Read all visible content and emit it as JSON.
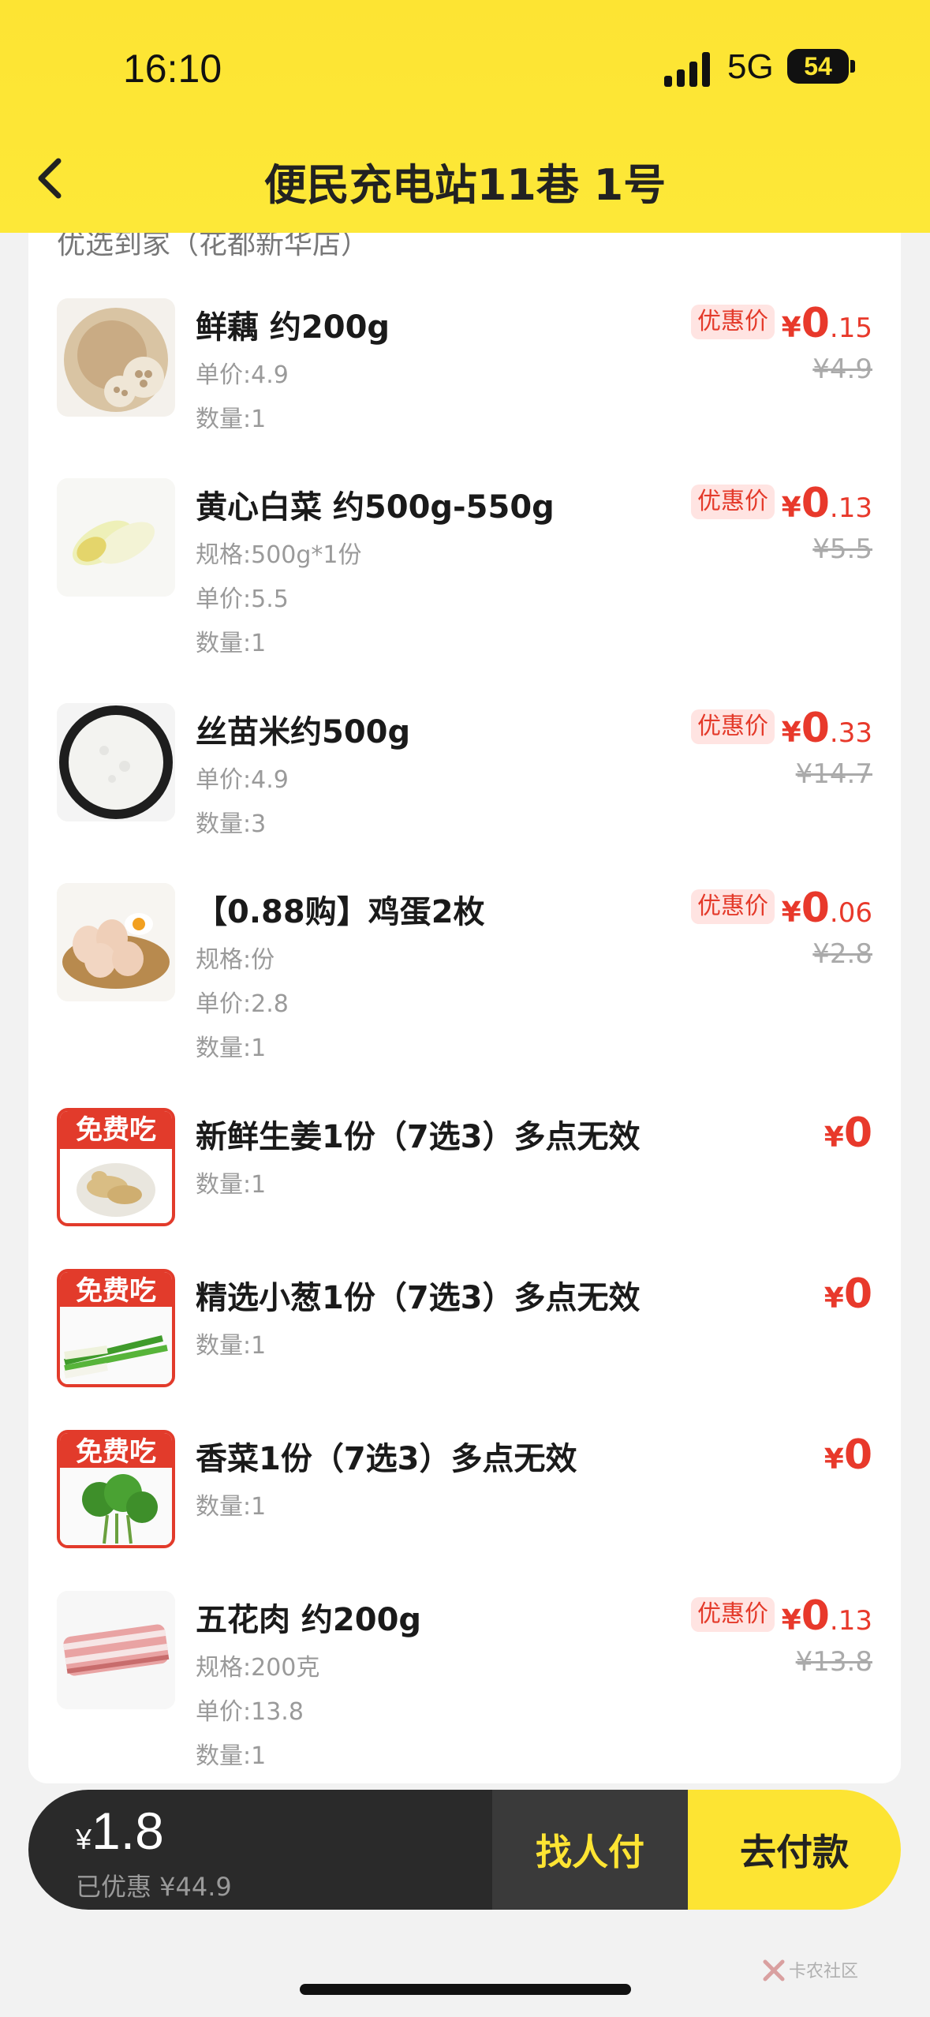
{
  "status_bar": {
    "time": "16:10",
    "network": "5G",
    "battery": "54"
  },
  "header": {
    "title": "便民充电站11巷 1号"
  },
  "store": {
    "name": "优选到家（花都新华店）"
  },
  "items": [
    {
      "name": "鲜藕 约200g",
      "spec": "",
      "unit_price": "单价:4.9",
      "quantity": "数量:1",
      "promo": "优惠价",
      "price_yen": "¥",
      "price_int": "0",
      "price_dec": ".15",
      "original": "¥4.9",
      "free": false,
      "free_label": ""
    },
    {
      "name": "黄心白菜 约500g-550g",
      "spec": "规格:500g*1份",
      "unit_price": "单价:5.5",
      "quantity": "数量:1",
      "promo": "优惠价",
      "price_yen": "¥",
      "price_int": "0",
      "price_dec": ".13",
      "original": "¥5.5",
      "free": false,
      "free_label": ""
    },
    {
      "name": "丝苗米约500g",
      "spec": "",
      "unit_price": "单价:4.9",
      "quantity": "数量:3",
      "promo": "优惠价",
      "price_yen": "¥",
      "price_int": "0",
      "price_dec": ".33",
      "original": "¥14.7",
      "free": false,
      "free_label": ""
    },
    {
      "name": "【0.88购】鸡蛋2枚",
      "spec": "规格:份",
      "unit_price": "单价:2.8",
      "quantity": "数量:1",
      "promo": "优惠价",
      "price_yen": "¥",
      "price_int": "0",
      "price_dec": ".06",
      "original": "¥2.8",
      "free": false,
      "free_label": ""
    },
    {
      "name": "新鲜生姜1份（7选3）多点无效",
      "spec": "",
      "unit_price": "",
      "quantity": "数量:1",
      "promo": "",
      "price_yen": "¥",
      "price_int": "0",
      "price_dec": "",
      "original": "",
      "free": true,
      "free_label": "免费吃"
    },
    {
      "name": "精选小葱1份（7选3）多点无效",
      "spec": "",
      "unit_price": "",
      "quantity": "数量:1",
      "promo": "",
      "price_yen": "¥",
      "price_int": "0",
      "price_dec": "",
      "original": "",
      "free": true,
      "free_label": "免费吃"
    },
    {
      "name": "香菜1份（7选3）多点无效",
      "spec": "",
      "unit_price": "",
      "quantity": "数量:1",
      "promo": "",
      "price_yen": "¥",
      "price_int": "0",
      "price_dec": "",
      "original": "",
      "free": true,
      "free_label": "免费吃"
    },
    {
      "name": "五花肉 约200g",
      "spec": "规格:200克",
      "unit_price": "单价:13.8",
      "quantity": "数量:1",
      "promo": "优惠价",
      "price_yen": "¥",
      "price_int": "0",
      "price_dec": ".13",
      "original": "¥13.8",
      "free": false,
      "free_label": ""
    }
  ],
  "bottom_bar": {
    "currency": "¥",
    "total": "1.8",
    "saved": "已优惠 ¥44.9",
    "share_label": "找人付",
    "pay_label": "去付款"
  },
  "watermark": {
    "text": "卡农社区"
  }
}
